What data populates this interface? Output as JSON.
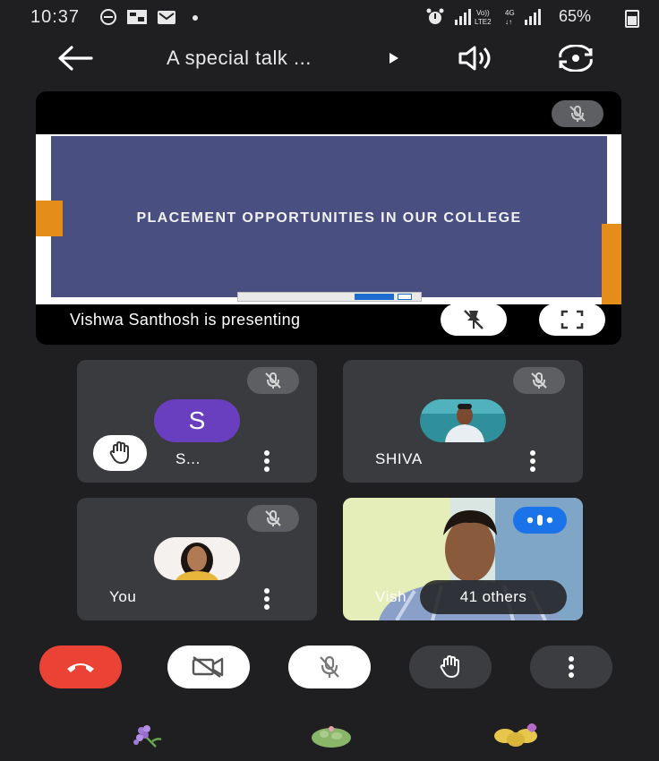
{
  "status_bar": {
    "time": "10:37",
    "network": ".ıl VoLTE2 4G .ıl",
    "battery": "65%"
  },
  "header": {
    "title": "A special talk ...",
    "icons": [
      "back-arrow-icon",
      "play-triangle-icon",
      "speaker-icon",
      "camera-switch-icon"
    ]
  },
  "presentation": {
    "slide_title": "PLACEMENT OPPORTUNITIES IN OUR COLLEGE",
    "label": "Vishwa Santhosh is presenting",
    "colors": {
      "slide_bg": "#4a4f82",
      "accent": "#e58d1b"
    }
  },
  "participants": [
    {
      "name": "S...",
      "avatar_letter": "S",
      "hand_raised": true,
      "muted": true
    },
    {
      "name": "SHIVA",
      "muted": true
    },
    {
      "name": "You",
      "muted": true
    },
    {
      "name": "Vish",
      "overlay": "41 others",
      "speaking": true
    }
  ],
  "controls": {
    "end_call_color": "#ea4335",
    "items": [
      "end-call",
      "camera-off",
      "mic-off",
      "raise-hand",
      "more-options"
    ]
  }
}
